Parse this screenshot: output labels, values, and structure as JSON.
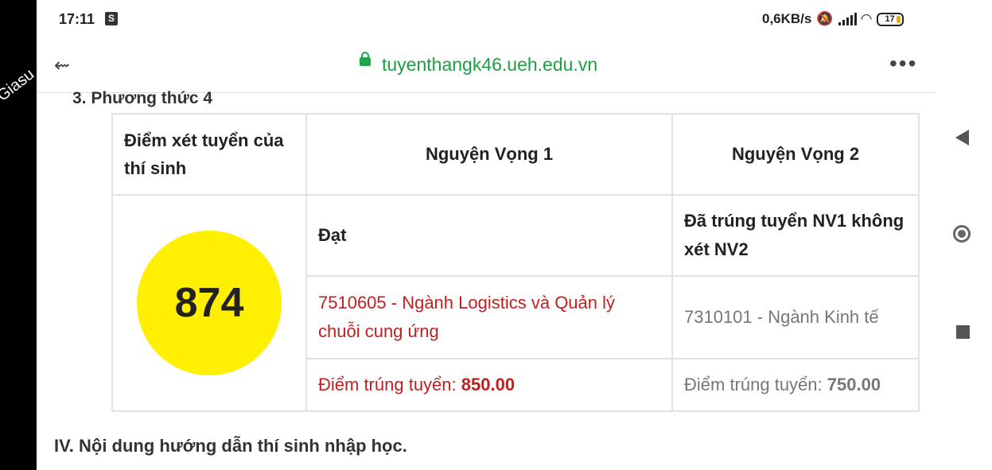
{
  "status_bar": {
    "time": "17:11",
    "app_badge": "S",
    "net_speed": "0,6KB/s",
    "battery": "17"
  },
  "browser": {
    "url": "tuyenthangk46.ueh.edu.vn",
    "menu_glyph": "•••",
    "back_glyph": "⇜"
  },
  "watermark": "Giasu",
  "page": {
    "section_heading": "3. Phương thức 4",
    "next_heading": "IV. Nội dung hướng dẫn thí sinh nhập học.",
    "table": {
      "header_col1": "Điểm xét tuyển của thí sinh",
      "header_col2": "Nguyện Vọng 1",
      "header_col3": "Nguyện Vọng 2",
      "score": "874",
      "nv1_status": "Đạt",
      "nv2_status": "Đã trúng tuyển NV1 không xét NV2",
      "nv1_major": "7510605 - Ngành Logistics và Quản lý chuỗi cung ứng",
      "nv2_major": "7310101 - Ngành Kinh tế",
      "nv1_cutoff_label": "Điểm trúng tuyển:",
      "nv1_cutoff_value": "850.00",
      "nv2_cutoff_label": "Điểm trúng tuyển:",
      "nv2_cutoff_value": "750.00"
    }
  },
  "colors": {
    "url_green": "#1e9e43",
    "accent_red": "#c21f1f",
    "score_yellow": "#ffef00"
  }
}
